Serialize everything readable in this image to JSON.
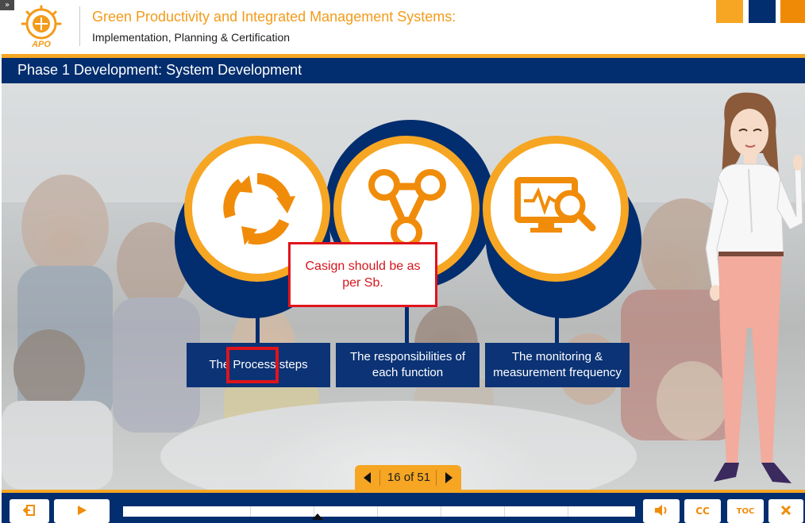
{
  "header": {
    "logo_text": "APO",
    "title": "Green Productivity and Integrated Management Systems:",
    "subtitle": "Implementation, Planning & Certification"
  },
  "slide": {
    "title": "Phase 1 Development: System Development"
  },
  "diagram": {
    "items": [
      {
        "label": "The Process steps",
        "icon": "refresh-cycle-icon"
      },
      {
        "label": "The responsibilities of each function",
        "icon": "linked-nodes-icon"
      },
      {
        "label": "The monitoring & measurement frequency",
        "icon": "monitor-search-icon"
      }
    ]
  },
  "annotation": {
    "text": "Casign should be as per Sb."
  },
  "navigation": {
    "page_indicator": "16 of 51"
  },
  "controls": {
    "exit_icon": "exit-icon",
    "play_icon": "play-icon",
    "volume_icon": "volume-icon",
    "cc_label": "CC",
    "toc_label": "TOC",
    "close_icon": "close-icon",
    "progress_fraction": 0.38
  },
  "colors": {
    "brand_orange": "#f6a623",
    "brand_navy": "#022d6e",
    "annotation_red": "#e0141c"
  }
}
